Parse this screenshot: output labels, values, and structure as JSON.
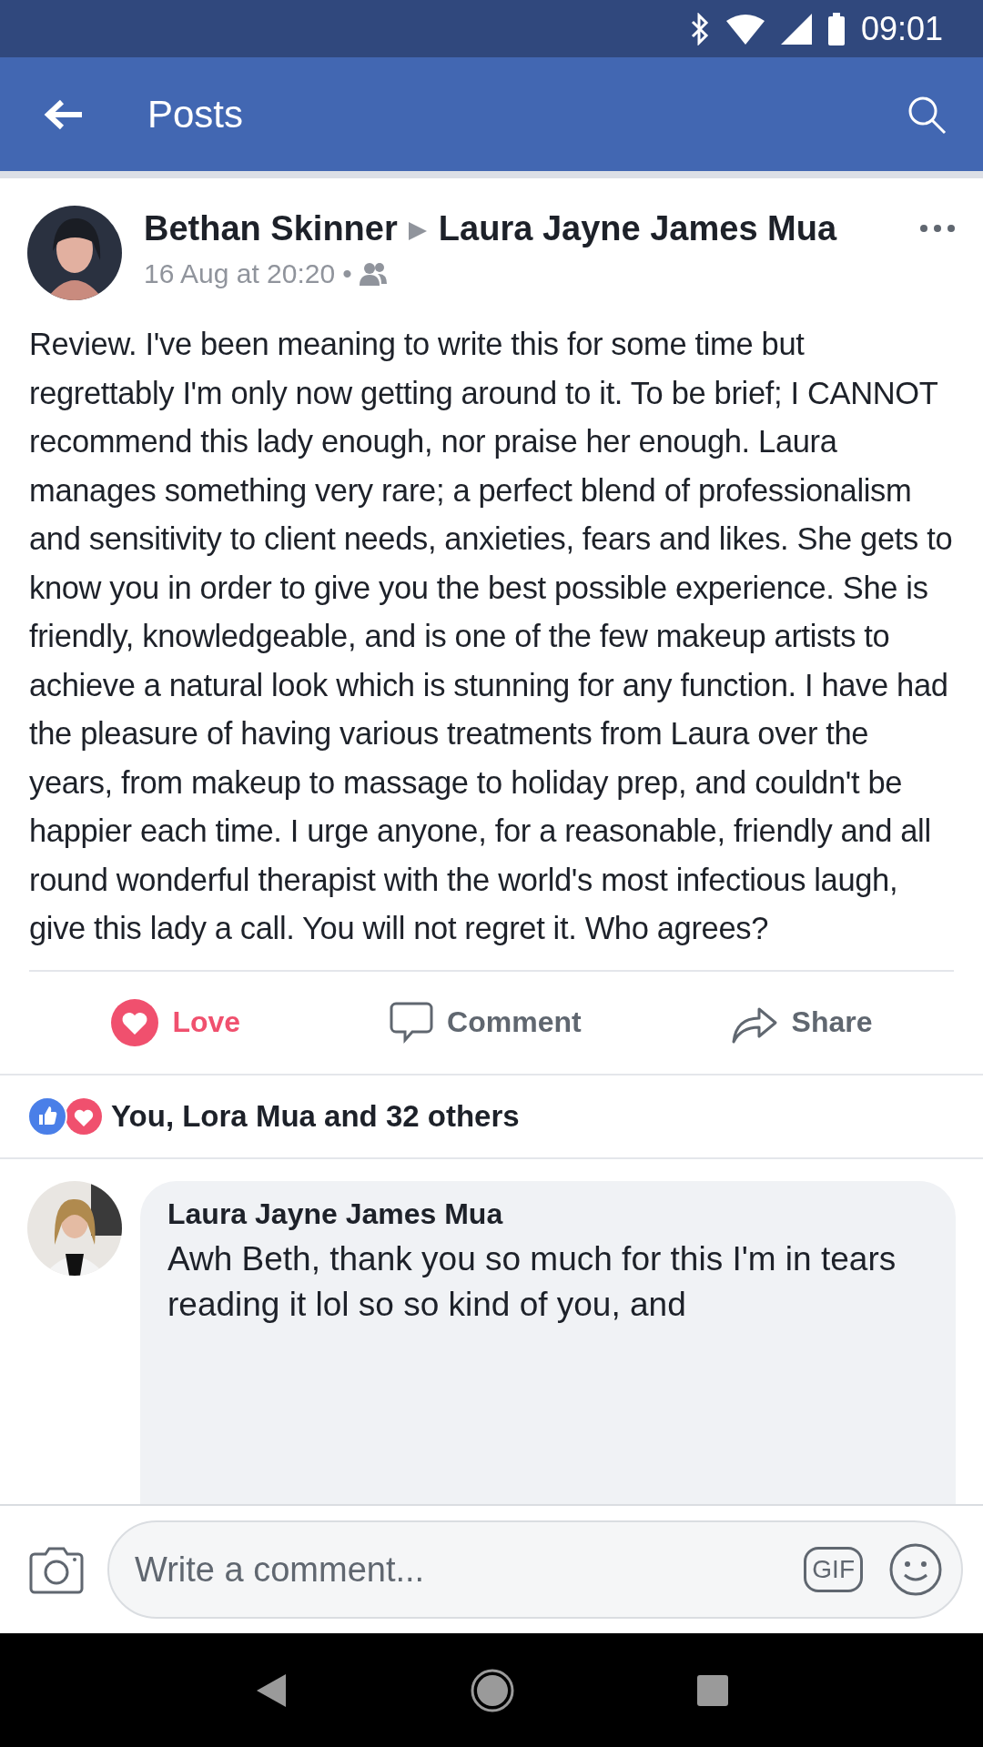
{
  "status_bar": {
    "time": "09:01"
  },
  "app_bar": {
    "title": "Posts"
  },
  "post": {
    "author": "Bethan Skinner",
    "target": "Laura Jayne James Mua",
    "date": "16 Aug at 20:20",
    "separator": "•",
    "body": "Review. I've been meaning to write this for some time but regrettably I'm only now getting around to it. To be brief; I CANNOT recommend this lady enough, nor praise her enough. Laura manages something very rare; a perfect blend of professionalism and sensitivity to client needs, anxieties, fears and likes. She gets to know you in order to give you the best possible experience. She is friendly, knowledgeable, and is one of the few makeup artists to achieve a natural look which is stunning for any function. I have had the pleasure of having various treatments from Laura over the years, from makeup to massage to holiday prep, and couldn't be happier each time. I urge anyone, for a reasonable, friendly and all round wonderful therapist with the world's most infectious laugh, give this lady a call. You will not regret it. Who agrees?",
    "actions": [
      {
        "kind": "love",
        "label": "Love",
        "selected": true
      },
      {
        "kind": "comment",
        "label": "Comment",
        "selected": false
      },
      {
        "kind": "share",
        "label": "Share",
        "selected": false
      }
    ],
    "reactions": "You, Lora Mua and 32 others"
  },
  "comment": {
    "author": "Laura Jayne James Mua",
    "text": "Awh Beth, thank you so much for this I'm in tears reading it lol so so kind of you, and"
  },
  "composer": {
    "placeholder": "Write a comment...",
    "gif": "GIF"
  }
}
